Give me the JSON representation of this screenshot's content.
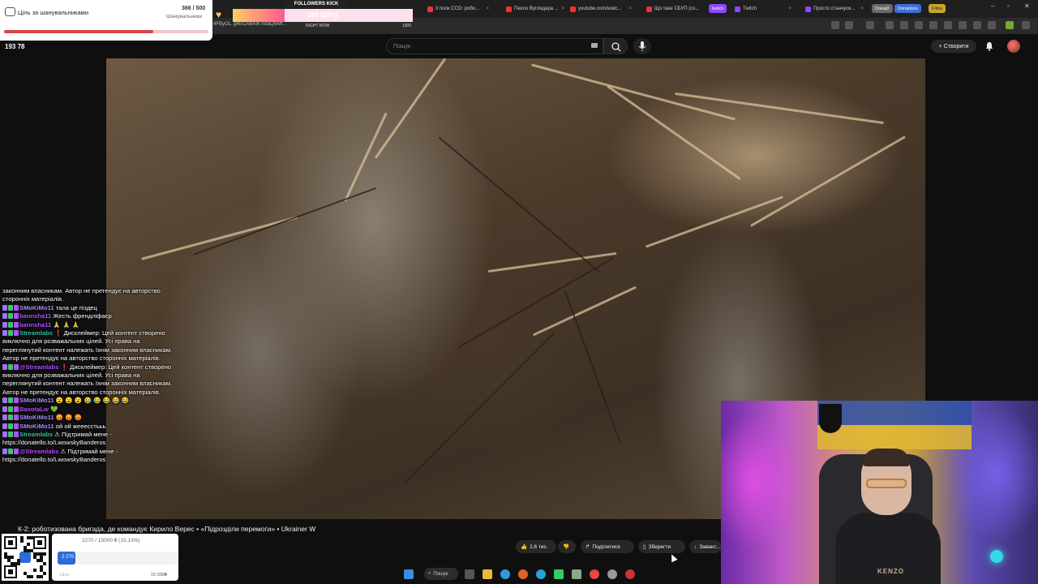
{
  "browser": {
    "tabs": [
      {
        "label": "",
        "color": "#4a8f3a"
      },
      {
        "label": "",
        "color": "#4a8f3a"
      },
      {
        "label": "",
        "color": "#d34"
      },
      {
        "label": "3 полк ССО: робо...",
        "color": "#e33"
      },
      {
        "label": "Пекло Вугледара ...",
        "color": "#e33"
      },
      {
        "label": "youtube.com/watc...",
        "color": "#e33"
      },
      {
        "label": "Що таке СБУП (сх...",
        "color": "#e33"
      },
      {
        "label": "Twitch",
        "color": "#9146ff"
      },
      {
        "label": "Просто станчуся...",
        "color": "#9146ff"
      }
    ],
    "pills": [
      "Donat2",
      "Donations",
      "Films"
    ],
    "twitch_pill": "twitch",
    "url": "4FByOL..g4ECABAIK-ndaQBMf..."
  },
  "youtube": {
    "search_placeholder": "Пошук",
    "create_label": "Створити",
    "video_title": "К-2: роботизована бригада, де командує Кирило Верес • «Підрозділи перемоги» • Ukrainer W",
    "actions": {
      "likes": "2,6 тис.",
      "share": "Поділитися",
      "save": "Зберегти",
      "download": "Завант..."
    }
  },
  "overlay": {
    "goal_title": "Ціль за шанувальниками",
    "goal_count": "366 / 500",
    "goal_sub": "Шанувальники",
    "goal_progress": 0.732,
    "followers_label": "FOLLOWERS KICK",
    "followers_value": "289 (28%)",
    "followers_progress": 0.289,
    "followers_now": "RIGHT NOW",
    "followers_max": "1000",
    "viewer_stats": "193    78"
  },
  "chat": [
    {
      "user": "",
      "color": "#ffffff",
      "text": "законним власникам. Автор не претендує на авторство сторонніх матеріалів."
    },
    {
      "user": "SMoKiMo11",
      "color": "#a88cff",
      "text": "тала це піздец"
    },
    {
      "user": "bannsha11",
      "color": "#b44cff",
      "text": "Жесть френдліфаєр"
    },
    {
      "user": "bannsha11",
      "color": "#b44cff",
      "text": "🙏 🙏 🙏"
    },
    {
      "user": "Streamlabs",
      "color": "#31c3a2",
      "text": "❗ Дисклеймер: Цей контент створено виключно для розважальних цілей. Усі права на переглянутий контент належать їхнім законним власникам. Автор не претендує на авторство сторонніх матеріалів."
    },
    {
      "user": "@Streamlabs",
      "color": "#b44cff",
      "text": "❗ Дисклеймер: Цей контент створено виключно для розважальних цілей. Усі права на переглянутий контент належать їхнім законним власникам. Автор не претендує на авторство сторонніх матеріалів."
    },
    {
      "user": "SMoKiMo11",
      "color": "#a88cff",
      "text": "😮 😮 😮 😂 😂 😂 😂 😂"
    },
    {
      "user": "BasotaLw",
      "color": "#b44cff",
      "text": "💚"
    },
    {
      "user": "SMoKiMo11",
      "color": "#a88cff",
      "text": "😡 😡 😡"
    },
    {
      "user": "SMoKiMo11",
      "color": "#a88cff",
      "text": "ой ой жееесстььь"
    },
    {
      "user": "Streamlabs",
      "color": "#31c3a2",
      "text": "⚠ Підтримай мене - https://donatello.to/LwowskyBanderos"
    },
    {
      "user": "@Streamlabs",
      "color": "#b44cff",
      "text": "⚠ Підтримай мене - https://donatello.to/LwowskyBanderos"
    }
  ],
  "donation": {
    "progress_text": "2270 / 15000 ₴ (15.13%)",
    "raised": "2 270",
    "goal": "15 000₴",
    "label": "Ціль",
    "progress": 0.1513
  },
  "taskbar": {
    "search_label": "Пошук"
  },
  "webcam": {
    "shirt_text": "KENZO"
  }
}
